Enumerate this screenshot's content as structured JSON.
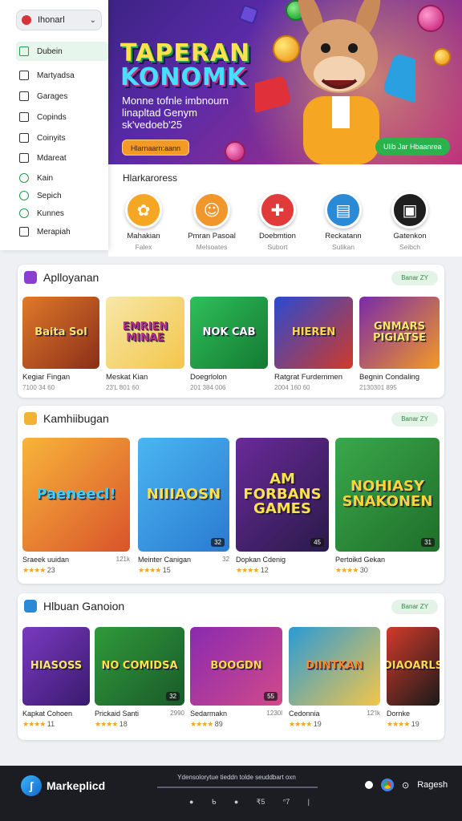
{
  "menu": {
    "selector": "Ihonarl",
    "items": [
      {
        "label": "Dubein",
        "active": true
      },
      {
        "label": "Martyadsa"
      },
      {
        "label": "Garages"
      },
      {
        "label": "Copinds"
      },
      {
        "label": "Coinyits"
      },
      {
        "label": "Mdareat"
      },
      {
        "label": "Kain",
        "green": true
      },
      {
        "label": "Sepich",
        "green": true
      },
      {
        "label": "Kunnes",
        "green": true
      },
      {
        "label": "Merapiah"
      }
    ]
  },
  "hero": {
    "title_line1": "TAPERAN",
    "title_line2": "KONOMK",
    "subtitle": "Monne tofnle imbnourn linapltad Genym sk'vedoeb'25",
    "left_button": "Hlarnaarn:aann",
    "right_button": "Ulib Jar Hbaanrea"
  },
  "categories": {
    "heading": "Hlarkaroress",
    "items": [
      {
        "name": "Mahakian",
        "sub": "Falex",
        "color": "#f5a623",
        "glyph": "✿"
      },
      {
        "name": "Pmran Pasoal",
        "sub": "Melsoates",
        "color": "#f0962a",
        "glyph": "☺"
      },
      {
        "name": "Doebmtion",
        "sub": "Subort",
        "color": "#e03a3a",
        "glyph": "✚"
      },
      {
        "name": "Reckatann",
        "sub": "Sulikan",
        "color": "#2a8ad6",
        "glyph": "▤"
      },
      {
        "name": "Gatenkon",
        "sub": "Seibch",
        "color": "#1e1e1e",
        "glyph": "▣"
      }
    ]
  },
  "sections": [
    {
      "title": "Aplloyanan",
      "pill": "Banar ZY",
      "icon_color": "#8b3fd1",
      "cards": [
        {
          "title": "Kegiar Fingan",
          "meta": "7100 34 60",
          "art": "Baita Sol",
          "bg1": "#e07a2a",
          "bg2": "#8a2e18",
          "fg": "#ffe46b"
        },
        {
          "title": "Meskat Kian",
          "meta": "23'L 801 60",
          "art": "EMRIEN MINAE",
          "bg1": "#f7e7a8",
          "bg2": "#f2c64a",
          "fg": "#b52f8f"
        },
        {
          "title": "Doegrlolon",
          "meta": "201 384 006",
          "art": "NOK CAB",
          "bg1": "#2fbf5a",
          "bg2": "#137a32",
          "fg": "#ffffff"
        },
        {
          "title": "Ratgrat Furdemmen",
          "meta": "2004 160 60",
          "art": "HIEREN",
          "bg1": "#2a4ad1",
          "bg2": "#d13a2a",
          "fg": "#ffd84a"
        },
        {
          "title": "Begnin Condaling",
          "meta": "2130301 895",
          "art": "GNMARS PIGIATSE",
          "bg1": "#7a2aa8",
          "bg2": "#f29a25",
          "fg": "#ffe46b"
        }
      ]
    },
    {
      "title": "Kamhiibugan",
      "pill": "Banar ZY",
      "icon_color": "#f2b233",
      "cards": [
        {
          "title": "Sraeek uuidan",
          "num": "121k",
          "rating": "23",
          "badge": "",
          "art": "Paeneecl!",
          "bg1": "#f7b53a",
          "bg2": "#d9532a",
          "fg": "#3ad0ff"
        },
        {
          "title": "Meinter Canigan",
          "num": "32",
          "rating": "15",
          "badge": "32",
          "art": "NIIIAOSN",
          "bg1": "#4ab6f0",
          "bg2": "#2a7ad1",
          "fg": "#ffe14d"
        },
        {
          "title": "Dopkan Cdenig",
          "num": "",
          "rating": "12",
          "badge": "45",
          "art": "AM FORBANS GAMES",
          "bg1": "#6a2a9a",
          "bg2": "#2a1a4a",
          "fg": "#ffe14d"
        },
        {
          "title": "Pertoikd Gekan",
          "num": "",
          "rating": "30",
          "badge": "31",
          "art": "NOHIASY SNAKONEN",
          "bg1": "#3aa84a",
          "bg2": "#1f6e2a",
          "fg": "#ffd33a"
        }
      ]
    },
    {
      "title": "Hlbuan Ganoion",
      "pill": "Banar ZY",
      "icon_color": "#2a8ad6",
      "cards": [
        {
          "title": "Kapkat Cohoen",
          "num": "",
          "rating": "11",
          "badge": "",
          "art": "HIASOSS",
          "bg1": "#7a3ac0",
          "bg2": "#3a1a6e",
          "fg": "#ffe46b"
        },
        {
          "title": "Prickaid Santi",
          "num": "2990",
          "rating": "18",
          "badge": "32",
          "art": "NO COMIDSA",
          "bg1": "#2f9a3a",
          "bg2": "#1a5a2a",
          "fg": "#ffe14d"
        },
        {
          "title": "Sedarmakn",
          "num": "1230l",
          "rating": "89",
          "badge": "55",
          "art": "BOOGDN",
          "bg1": "#8a2ab0",
          "bg2": "#d14a8a",
          "fg": "#ffd84a"
        },
        {
          "title": "Cedonnia",
          "num": "12'Ik",
          "rating": "19",
          "badge": "",
          "art": "DIINTKAN",
          "bg1": "#2a9ad6",
          "bg2": "#f2c64a",
          "fg": "#ff8a2a"
        },
        {
          "title": "Dornke",
          "num": "",
          "rating": "19",
          "badge": "",
          "art": "DIAOARLS",
          "bg1": "#d13a2a",
          "bg2": "#1a1a1a",
          "fg": "#ffd84a"
        }
      ]
    }
  ],
  "stars": "★★★★",
  "bottombar": {
    "name": "Markeplicd",
    "center_text": "Ydensolorytue tieddn  tolde seuddbart oxn",
    "icons": [
      "●",
      "ᑲ",
      "●",
      "₹5",
      "ᐢ7",
      "|"
    ],
    "right_label": "Ragesh"
  }
}
